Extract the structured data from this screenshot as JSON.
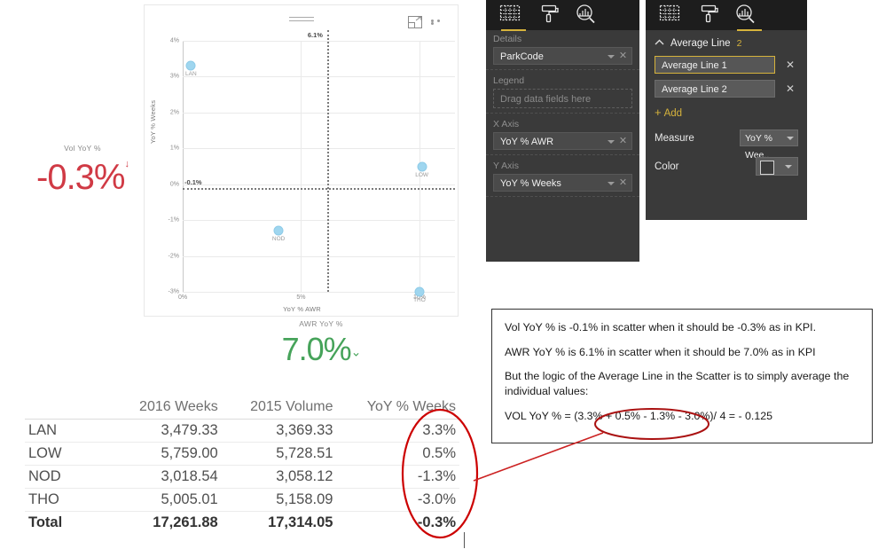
{
  "scatter": {
    "title_icons": {
      "drag": "drag-handle-icon",
      "focus": "focus-mode-icon",
      "more": "more-options-icon"
    },
    "x_axis_title": "YoY % AWR",
    "y_axis_title": "YoY % Weeks",
    "avg_x_label": "6.1%",
    "avg_y_label": "-0.1%"
  },
  "chart_data": {
    "type": "scatter",
    "title": "",
    "xlabel": "YoY % AWR",
    "ylabel": "YoY % Weeks",
    "xlim": [
      0,
      11.5
    ],
    "ylim": [
      -3,
      4
    ],
    "xticks": [
      "0%",
      "5%",
      "10%"
    ],
    "xtick_values": [
      0,
      5,
      10
    ],
    "yticks": [
      "4%",
      "3%",
      "2%",
      "1%",
      "0%",
      "-1%",
      "-2%",
      "-3%"
    ],
    "ytick_values": [
      4,
      3,
      2,
      1,
      0,
      -1,
      -2,
      -3
    ],
    "grid": true,
    "legend": "none",
    "points": [
      {
        "label": "LAN",
        "x": 0.35,
        "y": 3.3
      },
      {
        "label": "LOW",
        "x": 10.1,
        "y": 0.5
      },
      {
        "label": "NOD",
        "x": 4.05,
        "y": -1.3
      },
      {
        "label": "THO",
        "x": 10.0,
        "y": -3.0
      }
    ],
    "reference_lines": [
      {
        "name": "Average Line 1",
        "orientation": "horizontal",
        "value": -0.1,
        "label": "-0.1%"
      },
      {
        "name": "Average Line 2",
        "orientation": "vertical",
        "value": 6.1,
        "label": "6.1%"
      }
    ],
    "point_color": "#9fd6ef"
  },
  "kpi_vol": {
    "title": "Vol YoY %",
    "value": "-0.3%",
    "arrow": "↓",
    "color": "#d03a45"
  },
  "kpi_awr": {
    "title": "AWR YoY %",
    "value": "7.0%",
    "arrow": "⌄",
    "color": "#46a35a"
  },
  "table": {
    "columns": [
      "",
      "2016 Weeks",
      "2015 Volume",
      "YoY % Weeks"
    ],
    "rows": [
      {
        "label": "LAN",
        "weeks_2016": "3,479.33",
        "volume_2015": "3,369.33",
        "yoy": "3.3%"
      },
      {
        "label": "LOW",
        "weeks_2016": "5,759.00",
        "volume_2015": "5,728.51",
        "yoy": "0.5%"
      },
      {
        "label": "NOD",
        "weeks_2016": "3,018.54",
        "volume_2015": "3,058.12",
        "yoy": "-1.3%"
      },
      {
        "label": "THO",
        "weeks_2016": "5,005.01",
        "volume_2015": "5,158.09",
        "yoy": "-3.0%"
      }
    ],
    "total": {
      "label": "Total",
      "weeks_2016": "17,261.88",
      "volume_2015": "17,314.05",
      "yoy": "-0.3%"
    }
  },
  "fields_panel": {
    "tabs": [
      {
        "name": "fields-tab",
        "icon": "fields-grid-icon",
        "selected": true
      },
      {
        "name": "format-tab",
        "icon": "paint-roller-icon",
        "selected": false
      },
      {
        "name": "analytics-tab",
        "icon": "magnifier-chart-icon",
        "selected": false
      }
    ],
    "wells": [
      {
        "label": "Details",
        "value": "ParkCode",
        "empty": false
      },
      {
        "label": "Legend",
        "value": "Drag data fields here",
        "empty": true
      },
      {
        "label": "X Axis",
        "value": "YoY % AWR",
        "empty": false
      },
      {
        "label": "Y Axis",
        "value": "YoY % Weeks",
        "empty": false
      }
    ]
  },
  "analytics_panel": {
    "tabs": [
      {
        "name": "fields-tab",
        "icon": "fields-grid-icon",
        "selected": false
      },
      {
        "name": "format-tab",
        "icon": "paint-roller-icon",
        "selected": false
      },
      {
        "name": "analytics-tab",
        "icon": "magnifier-chart-icon",
        "selected": true
      }
    ],
    "section_title": "Average Line",
    "section_count": "2",
    "cards": [
      {
        "name": "Average Line 1",
        "active": true
      },
      {
        "name": "Average Line 2",
        "active": false
      }
    ],
    "add_label": "Add",
    "measure_label": "Measure",
    "measure_value": "YoY % Wee..",
    "color_label": "Color",
    "color_value": "#3d3d3d"
  },
  "note": {
    "line1": "Vol YoY % is -0.1% in scatter when it should be -0.3% as in KPI.",
    "line2": "AWR YoY % is 6.1% in scatter when it should be 7.0% as in KPI",
    "line3": "But the logic of the Average Line in the Scatter is to simply average the individual values:",
    "line4": "VOL YoY % = (3.3% + 0.5% - 1.3% - 3.0%)/ 4  =  - 0.125"
  }
}
